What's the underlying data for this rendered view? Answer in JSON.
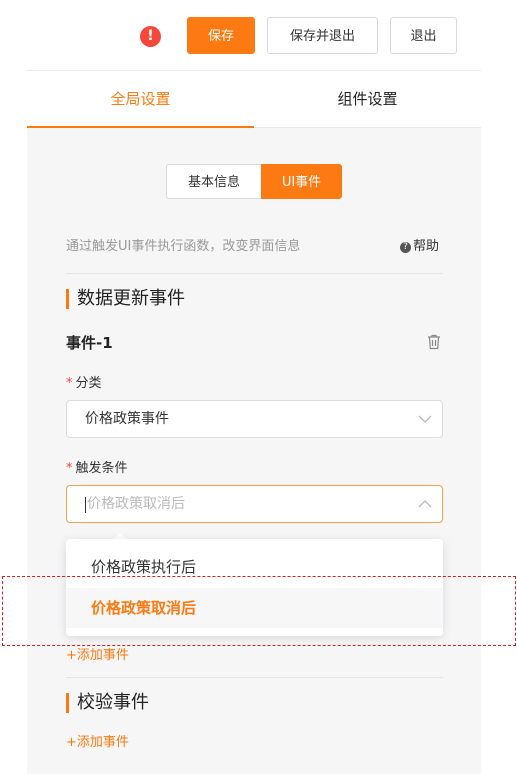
{
  "toolbar": {
    "alert_icon": "!",
    "save_label": "保存",
    "save_exit_label": "保存并退出",
    "exit_label": "退出"
  },
  "tabs": [
    {
      "label": "全局设置",
      "active": true
    },
    {
      "label": "组件设置",
      "active": false
    }
  ],
  "segment": {
    "basic_label": "基本信息",
    "ui_event_label": "UI事件",
    "selected": "UI事件"
  },
  "hint": {
    "text": "通过触发UI事件执行函数，改变界面信息",
    "help_icon": "?",
    "help_label": "帮助"
  },
  "data_update": {
    "section_title": "数据更新事件",
    "event_title": "事件-1",
    "category": {
      "required_mark": "*",
      "label": "分类",
      "value": "价格政策事件"
    },
    "trigger": {
      "required_mark": "*",
      "label": "触发条件",
      "placeholder": "价格政策取消后",
      "options": [
        {
          "label": "价格政策执行后",
          "selected": false
        },
        {
          "label": "价格政策取消后",
          "selected": true
        }
      ]
    },
    "add_event_label": "+添加事件"
  },
  "validation": {
    "section_title": "校验事件",
    "add_event_label": "+添加事件"
  },
  "colors": {
    "accent": "#fd7a12",
    "danger": "#f5483b",
    "annotation_outline": "#d62020"
  }
}
